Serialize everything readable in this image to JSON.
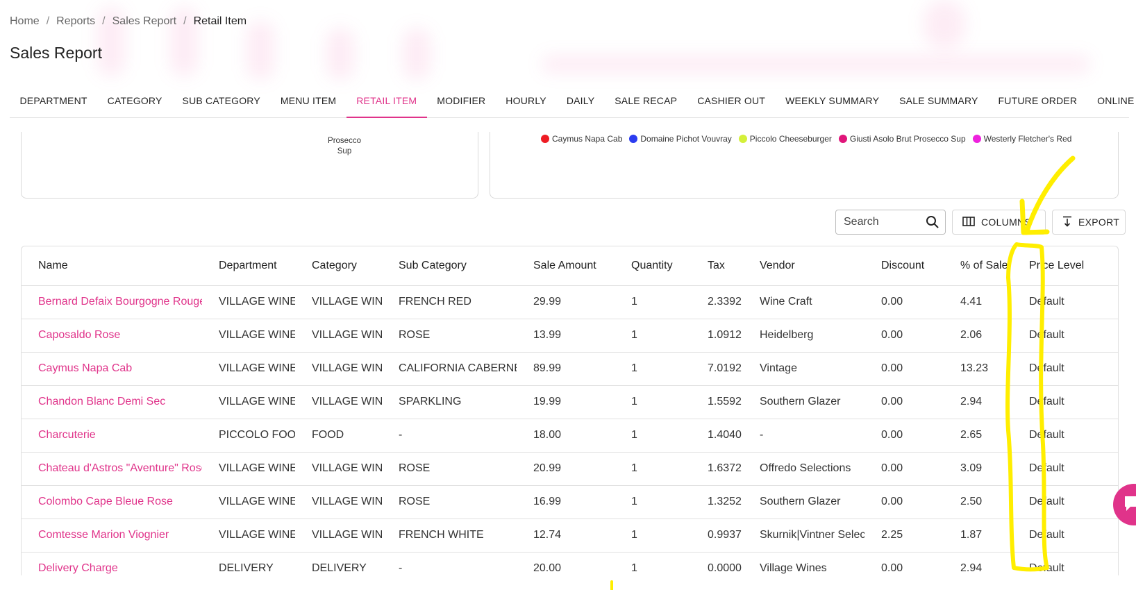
{
  "breadcrumb": [
    "Home",
    "Reports",
    "Sales Report",
    "Retail Item"
  ],
  "page_title": "Sales Report",
  "tabs": [
    {
      "label": "DEPARTMENT",
      "active": false
    },
    {
      "label": "CATEGORY",
      "active": false
    },
    {
      "label": "SUB CATEGORY",
      "active": false
    },
    {
      "label": "MENU ITEM",
      "active": false
    },
    {
      "label": "RETAIL ITEM",
      "active": true
    },
    {
      "label": "MODIFIER",
      "active": false
    },
    {
      "label": "HOURLY",
      "active": false
    },
    {
      "label": "DAILY",
      "active": false
    },
    {
      "label": "SALE RECAP",
      "active": false
    },
    {
      "label": "CASHIER OUT",
      "active": false
    },
    {
      "label": "WEEKLY SUMMARY",
      "active": false
    },
    {
      "label": "SALE SUMMARY",
      "active": false
    },
    {
      "label": "FUTURE ORDER",
      "active": false
    },
    {
      "label": "ONLINE SALES",
      "active": false
    }
  ],
  "pie_chart": {
    "visible_label_line1": "Prosecco",
    "visible_label_line2": "Sup"
  },
  "legend": [
    {
      "label": "Caymus Napa Cab",
      "color": "#ee1c24"
    },
    {
      "label": "Domaine Pichot Vouvray",
      "color": "#2b3cf0"
    },
    {
      "label": "Piccolo Cheeseburger",
      "color": "#d4f03a"
    },
    {
      "label": "Giusti Asolo Brut Prosecco Sup",
      "color": "#e0157a"
    },
    {
      "label": "Westerly Fletcher's Red",
      "color": "#ee22dd"
    }
  ],
  "toolbar": {
    "search_placeholder": "Search",
    "columns_label": "COLUMNS",
    "export_label": "EXPORT"
  },
  "table": {
    "columns": [
      "Name",
      "Department",
      "Category",
      "Sub Category",
      "Sale Amount",
      "Quantity",
      "Tax",
      "Vendor",
      "Discount",
      "% of Sale",
      "Price Level"
    ],
    "rows": [
      [
        "Bernard Defaix Bourgogne Rouge",
        "VILLAGE WINE",
        "VILLAGE WINE",
        "FRENCH RED",
        "29.99",
        "1",
        "2.3392",
        "Wine Craft",
        "0.00",
        "4.41",
        "Default"
      ],
      [
        "Caposaldo Rose",
        "VILLAGE WINE",
        "VILLAGE WINE",
        "ROSE",
        "13.99",
        "1",
        "1.0912",
        "Heidelberg",
        "0.00",
        "2.06",
        "Default"
      ],
      [
        "Caymus Napa Cab",
        "VILLAGE WINE",
        "VILLAGE WINE",
        "CALIFORNIA CABERNET",
        "89.99",
        "1",
        "7.0192",
        "Vintage",
        "0.00",
        "13.23",
        "Default"
      ],
      [
        "Chandon Blanc Demi Sec",
        "VILLAGE WINE",
        "VILLAGE WINE",
        "SPARKLING",
        "19.99",
        "1",
        "1.5592",
        "Southern Glazer",
        "0.00",
        "2.94",
        "Default"
      ],
      [
        "Charcuterie",
        "PICCOLO FOOD",
        "FOOD",
        "-",
        "18.00",
        "1",
        "1.4040",
        "-",
        "0.00",
        "2.65",
        "Default"
      ],
      [
        "Chateau d'Astros \"Aventure\" Rose",
        "VILLAGE WINE",
        "VILLAGE WINE",
        "ROSE",
        "20.99",
        "1",
        "1.6372",
        "Offredo Selections",
        "0.00",
        "3.09",
        "Default"
      ],
      [
        "Colombo Cape Bleue Rose",
        "VILLAGE WINE",
        "VILLAGE WINE",
        "ROSE",
        "16.99",
        "1",
        "1.3252",
        "Southern Glazer",
        "0.00",
        "2.50",
        "Default"
      ],
      [
        "Comtesse Marion Viognier",
        "VILLAGE WINE",
        "VILLAGE WINE",
        "FRENCH WHITE",
        "12.74",
        "1",
        "0.9937",
        "Skurnik|Vintner Select",
        "2.25",
        "1.87",
        "Default"
      ],
      [
        "Delivery Charge",
        "DELIVERY",
        "DELIVERY",
        "-",
        "20.00",
        "1",
        "0.0000",
        "Village Wines",
        "0.00",
        "2.94",
        "Default"
      ]
    ]
  },
  "colors": {
    "accent": "#e0338a",
    "annotation": "#ffee00"
  }
}
